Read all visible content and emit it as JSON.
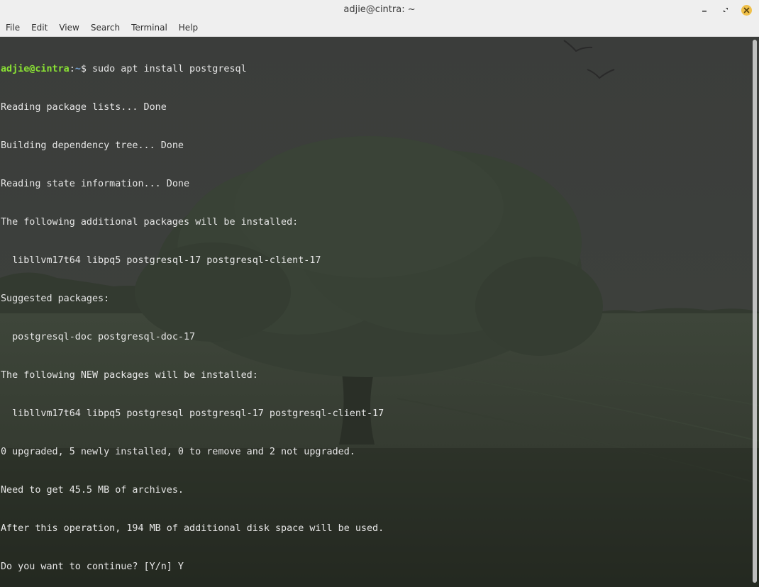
{
  "window": {
    "title": "adjie@cintra: ~"
  },
  "menu": {
    "file": "File",
    "edit": "Edit",
    "view": "View",
    "search": "Search",
    "terminal": "Terminal",
    "help": "Help"
  },
  "terminal": {
    "prompt_user_host": "adjie@cintra",
    "prompt_separator": ":",
    "prompt_path": "~",
    "prompt_symbol": "$ ",
    "command": "sudo apt install postgresql",
    "output": [
      "Reading package lists... Done",
      "Building dependency tree... Done",
      "Reading state information... Done",
      "The following additional packages will be installed:",
      "  libllvm17t64 libpq5 postgresql-17 postgresql-client-17",
      "Suggested packages:",
      "  postgresql-doc postgresql-doc-17",
      "The following NEW packages will be installed:",
      "  libllvm17t64 libpq5 postgresql postgresql-17 postgresql-client-17",
      "0 upgraded, 5 newly installed, 0 to remove and 2 not upgraded.",
      "Need to get 45.5 MB of archives.",
      "After this operation, 194 MB of additional disk space will be used.",
      "Do you want to continue? [Y/n] Y"
    ],
    "colors": {
      "user_host": "#8ae234",
      "path": "#729fcf",
      "text": "#e6e6e6"
    }
  },
  "icons": {
    "minimize": "minimize-icon",
    "maximize": "maximize-icon",
    "close": "close-icon"
  }
}
